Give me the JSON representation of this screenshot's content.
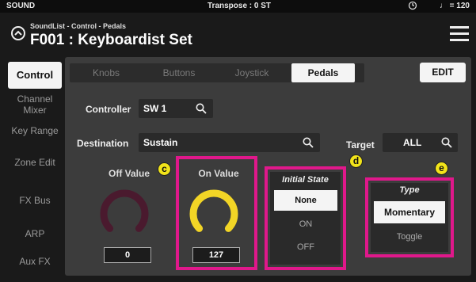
{
  "status_bar": {
    "mode": "SOUND",
    "transpose": "Transpose : 0 ST",
    "tempo": "♩ = 120"
  },
  "header": {
    "breadcrumb": "SoundList - Control - Pedals",
    "title": "F001 : Keyboardist Set"
  },
  "sidebar": {
    "items": [
      {
        "label": "Control"
      },
      {
        "label": "Channel Mixer"
      },
      {
        "label": "Key Range"
      },
      {
        "label": "Zone Edit"
      },
      {
        "label": "FX Bus"
      },
      {
        "label": "ARP"
      },
      {
        "label": "Aux FX"
      }
    ]
  },
  "tabs": [
    {
      "label": "Knobs"
    },
    {
      "label": "Buttons"
    },
    {
      "label": "Joystick"
    },
    {
      "label": "Pedals"
    }
  ],
  "edit_label": "EDIT",
  "controller": {
    "label": "Controller",
    "value": "SW 1"
  },
  "destination": {
    "label": "Destination",
    "value": "Sustain"
  },
  "target": {
    "label": "Target",
    "value": "ALL"
  },
  "off_value": {
    "label": "Off Value",
    "value": "0",
    "level": 0
  },
  "on_value": {
    "label": "On Value",
    "value": "127",
    "level": 1
  },
  "initial_state": {
    "title": "Initial State",
    "options": [
      "None",
      "ON",
      "OFF"
    ],
    "selected": "None"
  },
  "type": {
    "title": "Type",
    "options": [
      "Momentary",
      "Toggle"
    ],
    "selected": "Momentary"
  },
  "callouts": {
    "c": "c",
    "d": "d",
    "e": "e"
  },
  "colors": {
    "highlight": "#e0188b",
    "callout": "#f2e41a",
    "knob_on": "#f2d526",
    "knob_off": "#4a1a2e"
  }
}
